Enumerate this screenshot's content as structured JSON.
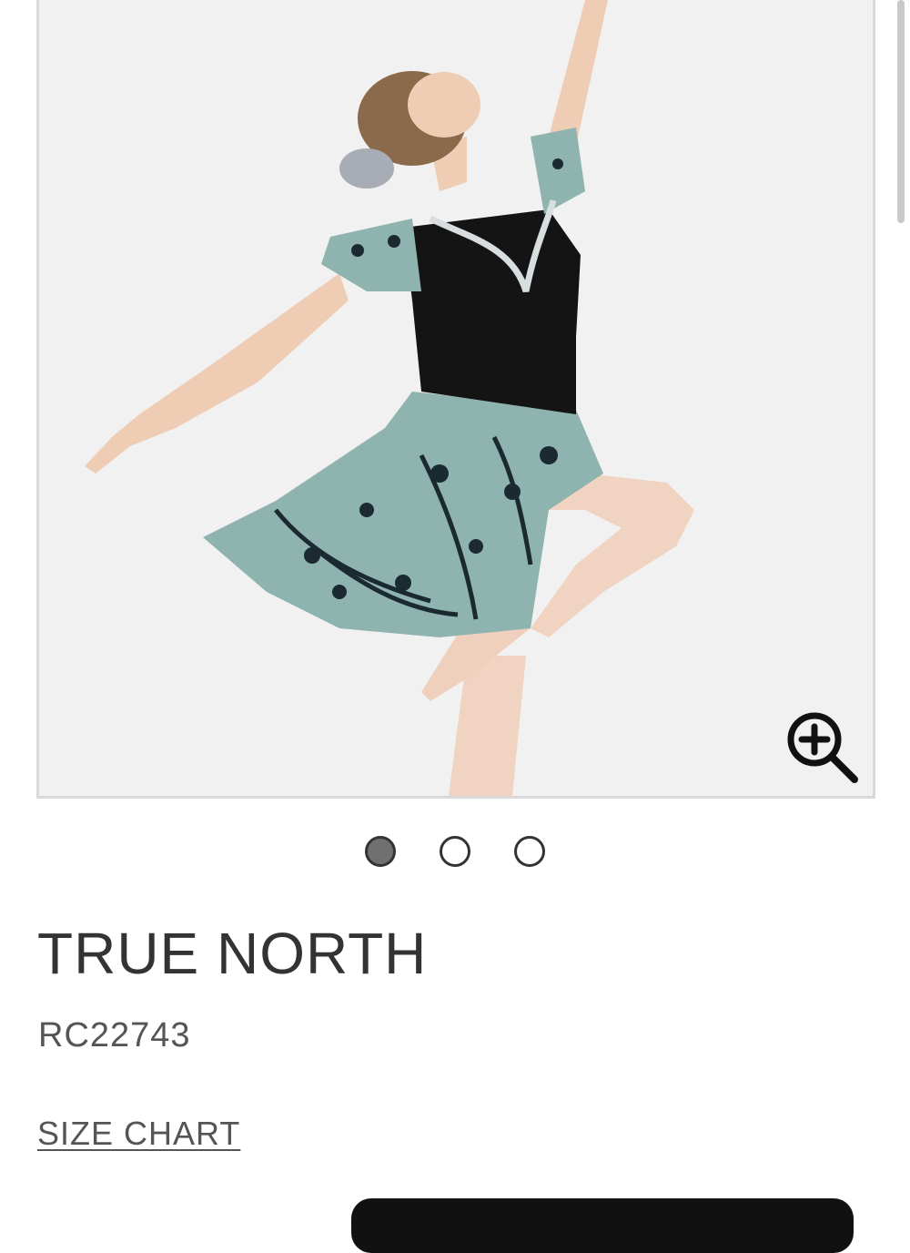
{
  "product": {
    "name": "TRUE NORTH",
    "sku": "RC22743",
    "size_chart_label": "SIZE CHART"
  },
  "gallery": {
    "image_count": 3,
    "active_index": 0,
    "zoom_icon": "zoom-in-icon"
  },
  "colors": {
    "text_dark": "#333333",
    "dot_active": "#707070",
    "cta_background": "#111111"
  }
}
